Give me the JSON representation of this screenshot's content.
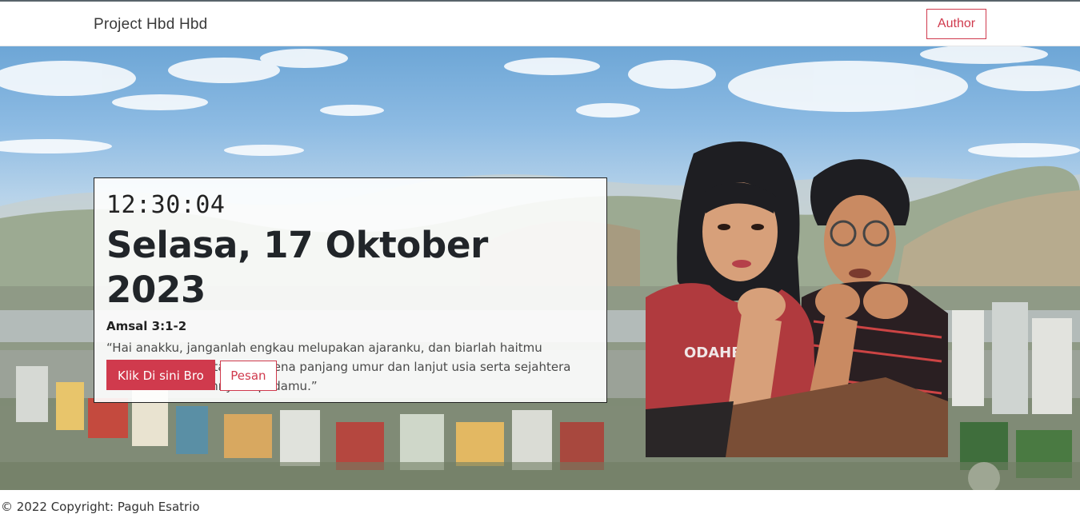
{
  "navbar": {
    "brand": "Project Hbd Hbd",
    "author_button": "Author"
  },
  "hero": {
    "clock": "12:30:04",
    "date": "Selasa, 17 Oktober 2023",
    "verse_ref": "Amsal 3:1-2",
    "verse_text": "“Hai anakku, janganlah engkau melupakan ajaranku, dan biarlah haitmu memelihara perintahku, karena panjang umur dan lanjut usia serta sejahtera akan ditambahkannya kepadamu.”",
    "primary_button": "Klik Di sini Bro",
    "secondary_button": "Pesan",
    "photo_shirt_text": "ODAHETAM"
  },
  "footer": {
    "copyright": "© 2022 Copyright: Paguh Esatrio"
  },
  "colors": {
    "accent": "#d03a4d",
    "navbar_bg": "#ffffff"
  },
  "icons": {
    "background": "village-landscape-image",
    "photo": "couple-illustration-image"
  }
}
